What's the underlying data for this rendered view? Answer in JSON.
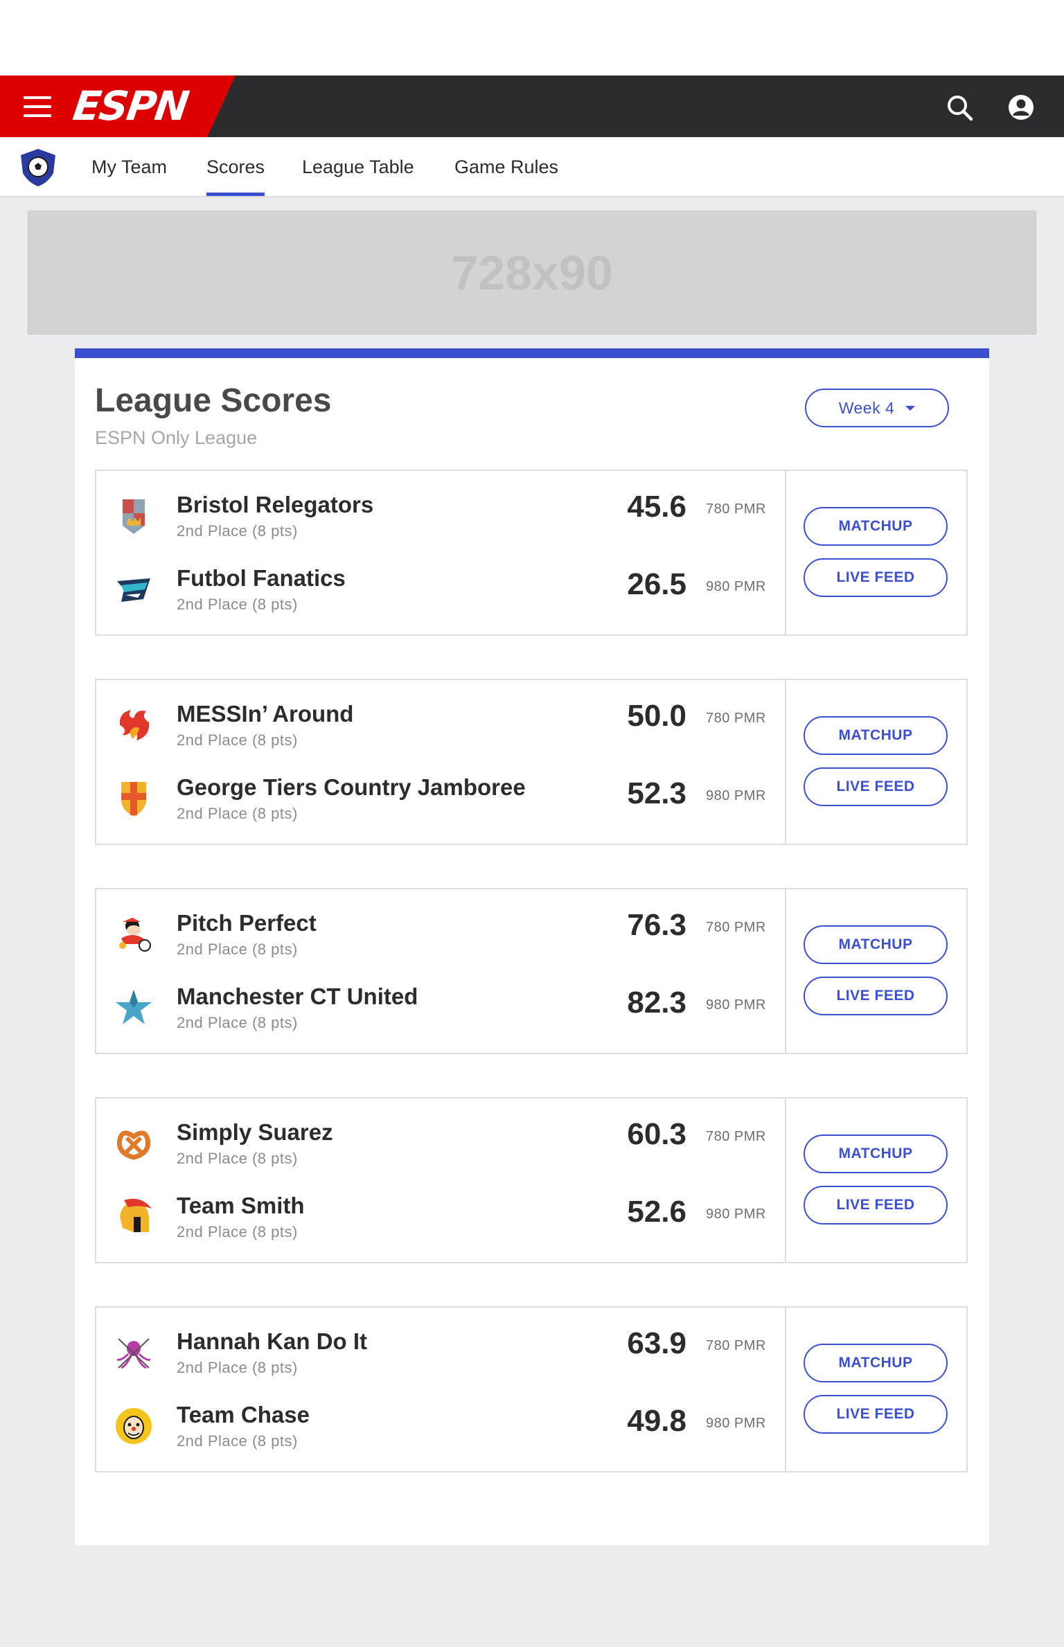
{
  "brand": {
    "logo_text": "ESPN",
    "red": "#dd0000",
    "dark": "#2b2c2d",
    "accent": "#3b4fd0"
  },
  "nav": {
    "items": [
      {
        "label": "My Team"
      },
      {
        "label": "Scores",
        "active": true
      },
      {
        "label": "League Table"
      },
      {
        "label": "Game Rules"
      }
    ]
  },
  "ad": {
    "label": "728x90"
  },
  "page": {
    "title": "League Scores",
    "subtitle": "ESPN Only League",
    "week_selector": "Week 4"
  },
  "matchups": [
    {
      "home": {
        "name": "Bristol Relegators",
        "place": "2nd Place (8 pts)",
        "score": "45.6",
        "pmr": "780 PMR",
        "logo": "castle-shield-icon"
      },
      "away": {
        "name": "Futbol Fanatics",
        "place": "2nd Place (8 pts)",
        "score": "26.5",
        "pmr": "980 PMR",
        "logo": "shark-icon"
      },
      "matchup_label": "MATCHUP",
      "live_label": "LIVE FEED"
    },
    {
      "home": {
        "name": "MESSIn’ Around",
        "place": "2nd Place (8 pts)",
        "score": "50.0",
        "pmr": "780 PMR",
        "logo": "flame-bird-icon"
      },
      "away": {
        "name": "George Tiers Country Jamboree",
        "place": "2nd Place (8 pts)",
        "score": "52.3",
        "pmr": "980 PMR",
        "logo": "cross-shield-icon"
      },
      "matchup_label": "MATCHUP",
      "live_label": "LIVE FEED"
    },
    {
      "home": {
        "name": "Pitch Perfect",
        "place": "2nd Place (8 pts)",
        "score": "76.3",
        "pmr": "780 PMR",
        "logo": "cartoon-mascot-icon"
      },
      "away": {
        "name": "Manchester CT United",
        "place": "2nd Place (8 pts)",
        "score": "82.3",
        "pmr": "980 PMR",
        "logo": "star-icon"
      },
      "matchup_label": "MATCHUP",
      "live_label": "LIVE FEED"
    },
    {
      "home": {
        "name": "Simply Suarez",
        "place": "2nd Place (8 pts)",
        "score": "60.3",
        "pmr": "780 PMR",
        "logo": "pretzel-icon"
      },
      "away": {
        "name": "Team Smith",
        "place": "2nd Place (8 pts)",
        "score": "52.6",
        "pmr": "980 PMR",
        "logo": "spartan-helmet-icon"
      },
      "matchup_label": "MATCHUP",
      "live_label": "LIVE FEED"
    },
    {
      "home": {
        "name": "Hannah Kan Do It",
        "place": "2nd Place (8 pts)",
        "score": "63.9",
        "pmr": "780 PMR",
        "logo": "octopus-icon"
      },
      "away": {
        "name": "Team Chase",
        "place": "2nd Place (8 pts)",
        "score": "49.8",
        "pmr": "980 PMR",
        "logo": "clown-face-icon"
      },
      "matchup_label": "MATCHUP",
      "live_label": "LIVE FEED"
    }
  ]
}
